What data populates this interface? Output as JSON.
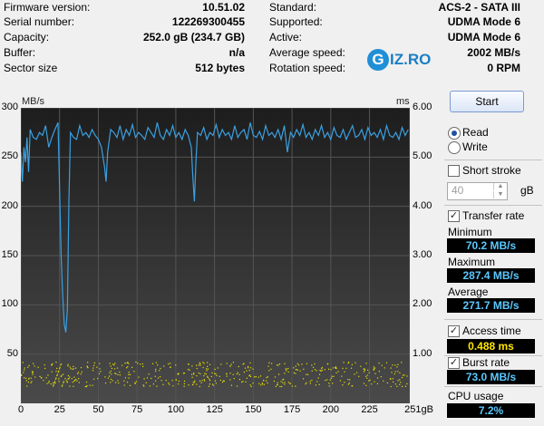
{
  "info_left": [
    {
      "label": "Firmware version:",
      "value": "10.51.02"
    },
    {
      "label": "Serial number:",
      "value": "122269300455"
    },
    {
      "label": "Capacity:",
      "value": "252.0 gB (234.7 GB)"
    },
    {
      "label": "Buffer:",
      "value": "n/a"
    },
    {
      "label": "Sector size",
      "value": "512 bytes"
    }
  ],
  "info_right": [
    {
      "label": "Standard:",
      "value": "ACS-2 - SATA III"
    },
    {
      "label": "Supported:",
      "value": "UDMA Mode 6"
    },
    {
      "label": "Active:",
      "value": "UDMA Mode 6"
    },
    {
      "label": "Average speed:",
      "value": "2002 MB/s"
    },
    {
      "label": "Rotation speed:",
      "value": "0 RPM"
    }
  ],
  "logo": {
    "mark": "G",
    "text": "IZ.RO"
  },
  "chart_data": {
    "type": "line",
    "y_unit_left": "MB/s",
    "y_unit_right": "ms",
    "x_unit": "gB",
    "ylim": [
      0,
      300
    ],
    "ylim_right": [
      0,
      6.0
    ],
    "xlim": [
      0,
      251
    ],
    "yticks": [
      "300",
      "250",
      "200",
      "150",
      "100",
      "50"
    ],
    "yticks_right": [
      "6.00",
      "5.00",
      "4.00",
      "3.00",
      "2.00",
      "1.00"
    ],
    "xticks": [
      "0",
      "25",
      "50",
      "75",
      "100",
      "125",
      "150",
      "175",
      "200",
      "225",
      "251gB"
    ],
    "transfer_series": {
      "name": "Transfer rate",
      "color": "#3aa0e0",
      "x": [
        0,
        1,
        2,
        3,
        4,
        5,
        6,
        8,
        10,
        12,
        14,
        16,
        18,
        20,
        22,
        24,
        26,
        27,
        28,
        29,
        30,
        31,
        32,
        34,
        36,
        38,
        40,
        42,
        44,
        46,
        48,
        50,
        52,
        54,
        55,
        56,
        58,
        60,
        62,
        64,
        66,
        68,
        70,
        72,
        74,
        76,
        78,
        80,
        82,
        84,
        86,
        88,
        90,
        92,
        94,
        96,
        98,
        100,
        102,
        104,
        106,
        108,
        110,
        111,
        112,
        113,
        114,
        116,
        118,
        120,
        122,
        124,
        126,
        128,
        130,
        132,
        134,
        136,
        138,
        140,
        142,
        144,
        146,
        148,
        150,
        152,
        154,
        156,
        158,
        160,
        162,
        164,
        166,
        168,
        170,
        172,
        174,
        176,
        178,
        180,
        182,
        184,
        186,
        188,
        190,
        192,
        194,
        196,
        198,
        200,
        202,
        204,
        206,
        208,
        210,
        212,
        214,
        216,
        218,
        220,
        222,
        224,
        226,
        228,
        230,
        232,
        234,
        236,
        238,
        240,
        242,
        244,
        246,
        248,
        250
      ],
      "y": [
        255,
        225,
        260,
        245,
        270,
        235,
        278,
        270,
        268,
        275,
        272,
        282,
        260,
        270,
        278,
        285,
        150,
        110,
        80,
        72,
        95,
        205,
        275,
        270,
        268,
        282,
        272,
        275,
        270,
        278,
        272,
        268,
        260,
        240,
        225,
        255,
        278,
        275,
        270,
        282,
        268,
        278,
        272,
        283,
        270,
        275,
        272,
        268,
        280,
        275,
        270,
        285,
        272,
        268,
        278,
        272,
        282,
        270,
        275,
        268,
        278,
        272,
        260,
        230,
        205,
        245,
        275,
        272,
        280,
        268,
        275,
        272,
        283,
        270,
        278,
        272,
        275,
        268,
        282,
        270,
        275,
        278,
        268,
        285,
        272,
        270,
        276,
        268,
        282,
        272,
        275,
        270,
        278,
        268,
        282,
        255,
        275,
        270,
        278,
        272,
        283,
        270,
        275,
        268,
        278,
        272,
        282,
        270,
        275,
        268,
        280,
        272,
        270,
        278,
        268,
        275,
        282,
        270,
        272,
        278,
        268,
        280,
        272,
        275,
        270,
        278,
        268,
        282,
        272,
        270,
        275,
        268,
        280,
        272,
        278
      ]
    },
    "access_series": {
      "name": "Access time",
      "color": "#e8e000",
      "y_range_ms": [
        0.35,
        0.85
      ]
    }
  },
  "panel": {
    "start_label": "Start",
    "read_label": "Read",
    "write_label": "Write",
    "short_stroke_label": "Short stroke",
    "short_stroke_value": "40",
    "short_stroke_unit": "gB",
    "transfer_rate_label": "Transfer rate",
    "minimum_label": "Minimum",
    "minimum_value": "70.2 MB/s",
    "maximum_label": "Maximum",
    "maximum_value": "287.4 MB/s",
    "average_label": "Average",
    "average_value": "271.7 MB/s",
    "access_time_label": "Access time",
    "access_time_value": "0.488 ms",
    "burst_rate_label": "Burst rate",
    "burst_rate_value": "73.0 MB/s",
    "cpu_usage_label": "CPU usage",
    "cpu_usage_value": "7.2%",
    "read_selected": true,
    "short_stroke_checked": false,
    "transfer_rate_checked": true,
    "access_time_checked": true,
    "burst_rate_checked": true
  }
}
